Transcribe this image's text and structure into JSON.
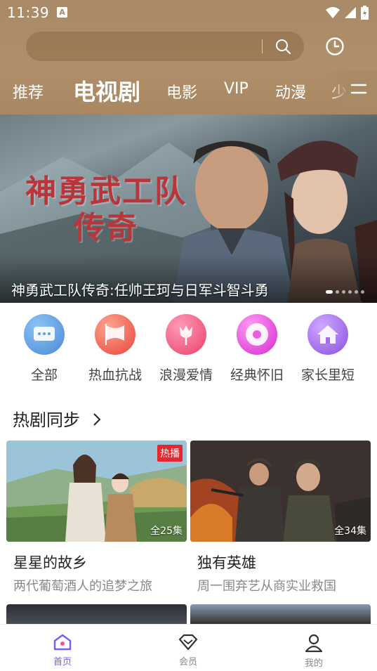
{
  "status_bar": {
    "time": "11:39",
    "notification_icon": "A"
  },
  "search": {
    "placeholder": ""
  },
  "tabs": [
    "推荐",
    "电视剧",
    "电影",
    "VIP",
    "动漫",
    "少"
  ],
  "active_tab": "电视剧",
  "banner": {
    "art_title_line1": "神勇武工队",
    "art_title_line2": "传奇",
    "caption": "神勇武工队传奇:任帅王珂与日军斗智斗勇"
  },
  "categories": [
    {
      "label": "全部",
      "icon": "chat-dots-icon",
      "color": "#5b9fe6"
    },
    {
      "label": "热血抗战",
      "icon": "flag-icon",
      "color": "#f0665a"
    },
    {
      "label": "浪漫爱情",
      "icon": "rose-icon",
      "color": "#f2577f"
    },
    {
      "label": "经典怀旧",
      "icon": "disc-icon",
      "color": "#ea5fe0"
    },
    {
      "label": "家长里短",
      "icon": "house-icon",
      "color": "#a26ee8"
    }
  ],
  "section": {
    "title": "热剧同步"
  },
  "cards": [
    {
      "title": "星星的故乡",
      "subtitle": "两代葡萄酒人的追梦之旅",
      "badge": "热播",
      "episodes": "全25集"
    },
    {
      "title": "独有英雄",
      "subtitle": "周一围弃艺从商实业救国",
      "badge": "",
      "episodes": "全34集"
    }
  ],
  "bottom_nav": [
    {
      "label": "首页",
      "icon": "home-icon",
      "active": true
    },
    {
      "label": "会员",
      "icon": "vip-diamond-icon",
      "active": false
    },
    {
      "label": "我的",
      "icon": "profile-icon",
      "active": false
    }
  ],
  "colors": {
    "header": "#a98a66",
    "accent": "#7c5cf0",
    "hot_badge": "#e6262f"
  }
}
